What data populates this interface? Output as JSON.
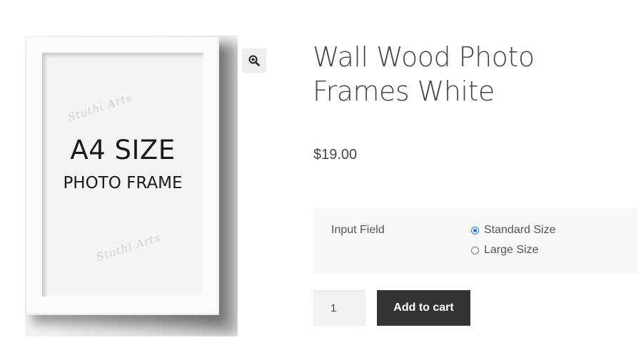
{
  "product": {
    "image": {
      "size_text": "A4 SIZE",
      "frame_text": "PHOTO FRAME",
      "watermark": "Stuthi Arts"
    },
    "zoom_icon": "magnifier-zoom-icon",
    "title": "Wall Wood Photo Frames White",
    "price": "$19.00"
  },
  "options": {
    "label": "Input Field",
    "choices": [
      {
        "label": "Standard Size",
        "selected": true
      },
      {
        "label": "Large Size",
        "selected": false
      }
    ],
    "accent_color": "#1a73e8"
  },
  "cart": {
    "quantity": "1",
    "add_to_cart_label": "Add to cart"
  }
}
